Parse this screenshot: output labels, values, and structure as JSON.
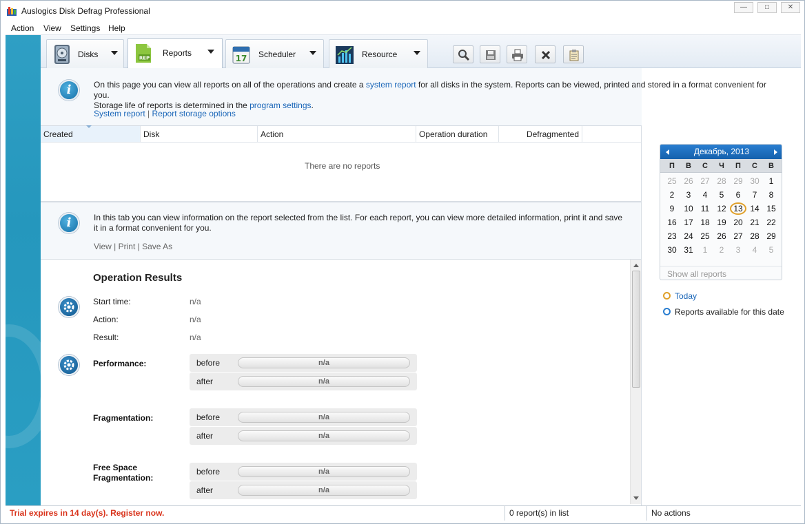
{
  "window": {
    "title": "Auslogics Disk Defrag Professional",
    "min_label": "—",
    "max_label": "□",
    "close_label": "✕"
  },
  "menu": [
    "Action",
    "View",
    "Settings",
    "Help"
  ],
  "tabs": [
    {
      "label": "Disks",
      "icon": "disk-icon"
    },
    {
      "label": "Reports",
      "icon": "report-icon"
    },
    {
      "label": "Scheduler",
      "icon": "calendar-icon"
    },
    {
      "label": "Resource",
      "icon": "chart-icon"
    }
  ],
  "scheduler_icon_text": "17",
  "reports_icon_text": "REP",
  "toolbar": [
    "search-icon",
    "save-icon",
    "print-icon",
    "close-icon",
    "clipboard-icon"
  ],
  "info_top": {
    "t1": "On this page you can view all reports on all of the operations and create a ",
    "link1": "system report",
    "t2": " for all disks in the system. Reports can be viewed, printed and stored in a format convenient for you.",
    "t3": "Storage life of reports is determined in the ",
    "link2": "program settings",
    "t4": ".",
    "action1": "System report",
    "sep": "|",
    "action2": "Report storage options"
  },
  "list": {
    "columns": [
      "Created",
      "Disk",
      "Action",
      "Operation duration",
      "Defragmented"
    ],
    "empty_text": "There are no reports"
  },
  "info_bottom": {
    "text1": "In this tab you can view information on the report selected from the list. For each report, you can view more detailed information, print it and save",
    "text2": "it in a format convenient for you.",
    "view": "View",
    "print": "Print",
    "saveas": "Save As",
    "sep": "|"
  },
  "results": {
    "title": "Operation Results",
    "start_label": "Start time:",
    "start_value": "n/a",
    "action_label": "Action:",
    "action_value": "n/a",
    "result_label": "Result:",
    "result_value": "n/a",
    "performance": "Performance:",
    "fragmentation": "Fragmentation:",
    "free_space_1": "Free Space",
    "free_space_2": "Fragmentation:",
    "before": "before",
    "after": "after",
    "na": "n/a"
  },
  "calendar": {
    "month": "Декабрь, 2013",
    "dow": [
      "П",
      "В",
      "С",
      "Ч",
      "П",
      "С",
      "В"
    ],
    "weeks": [
      [
        "25",
        "26",
        "27",
        "28",
        "29",
        "30",
        "1"
      ],
      [
        "2",
        "3",
        "4",
        "5",
        "6",
        "7",
        "8"
      ],
      [
        "9",
        "10",
        "11",
        "12",
        "13",
        "14",
        "15"
      ],
      [
        "16",
        "17",
        "18",
        "19",
        "20",
        "21",
        "22"
      ],
      [
        "23",
        "24",
        "25",
        "26",
        "27",
        "28",
        "29"
      ],
      [
        "30",
        "31",
        "1",
        "2",
        "3",
        "4",
        "5"
      ]
    ],
    "today": "13",
    "show_all": "Show all reports",
    "legend_today": "Today",
    "legend_reports": "Reports available for this date",
    "today_color": "#e0a02a",
    "reports_color": "#2a7ed0"
  },
  "status": {
    "trial": "Trial expires in 14 day(s). Register now.",
    "count": "0 report(s) in list",
    "actions": "No actions"
  }
}
